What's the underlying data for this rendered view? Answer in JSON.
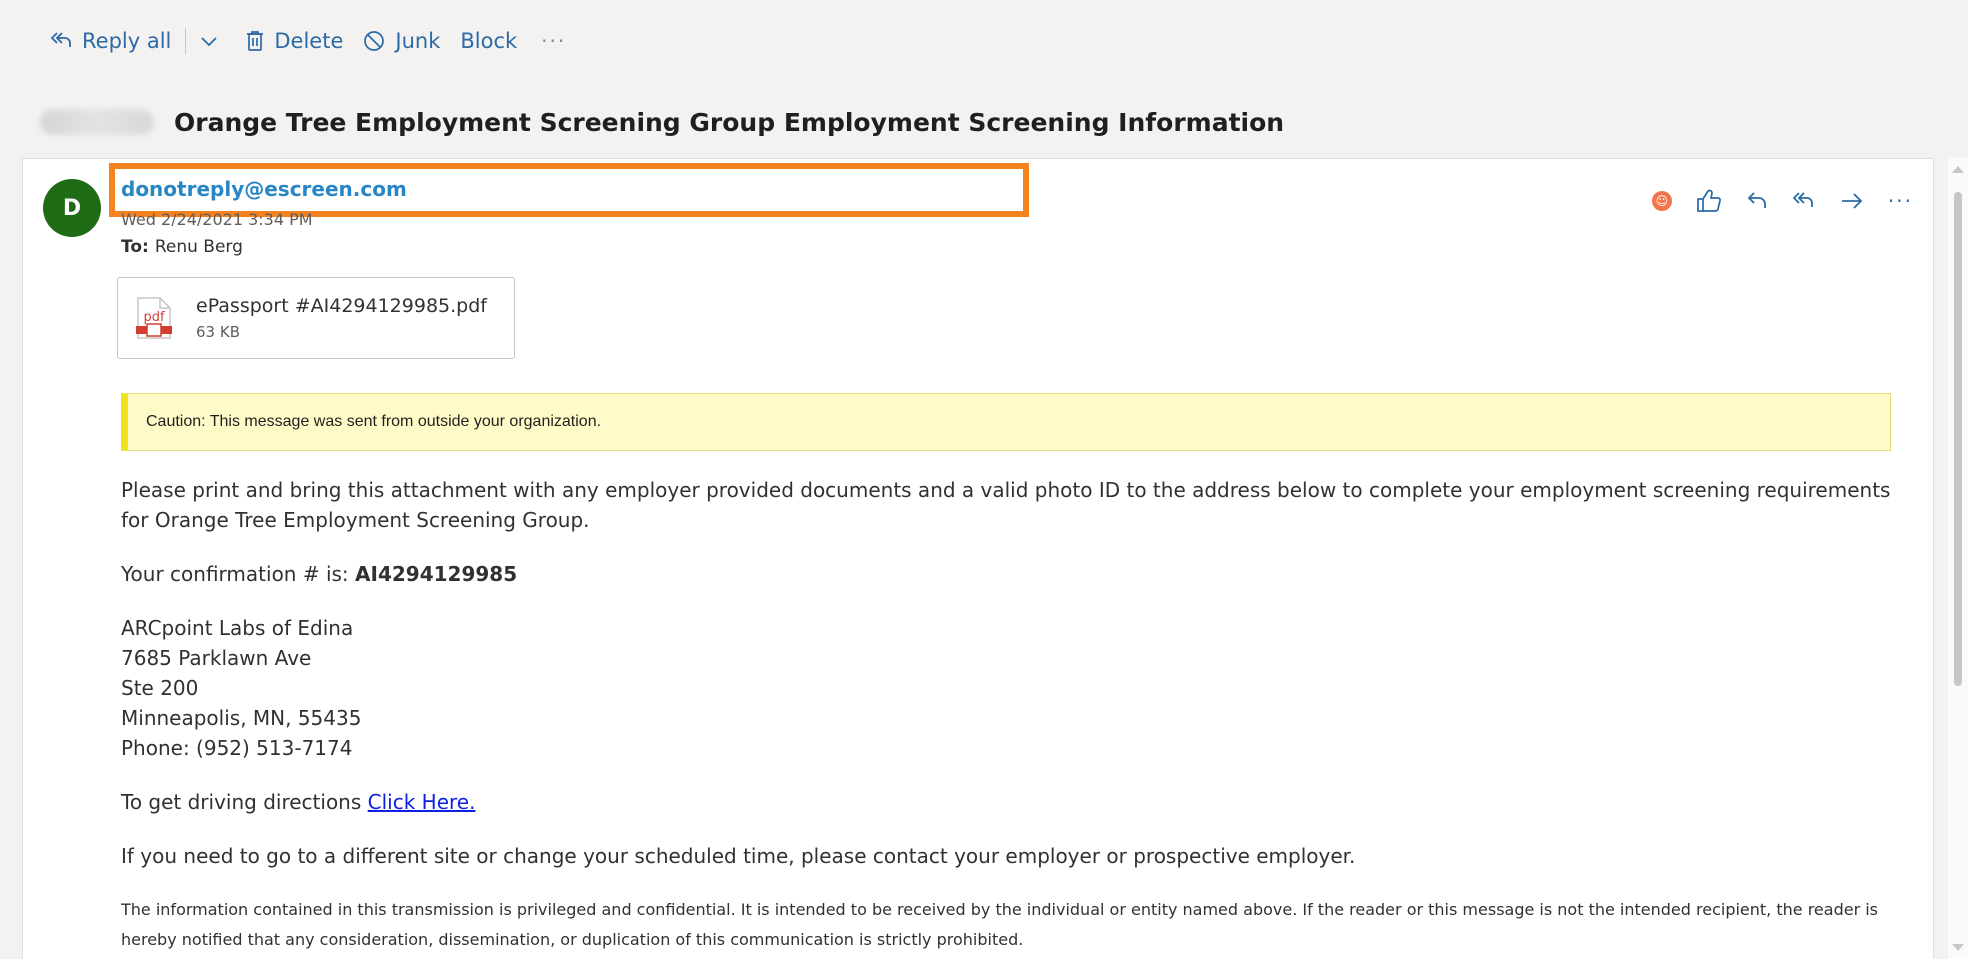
{
  "toolbar": {
    "reply_all": "Reply all",
    "delete": "Delete",
    "junk": "Junk",
    "block": "Block",
    "more": "···"
  },
  "subject": "Orange Tree Employment Screening Group Employment Screening Information",
  "message": {
    "avatar_initial": "D",
    "sender": "donotreply@escreen.com",
    "date": "Wed 2/24/2021 3:34 PM",
    "to_label": "To:",
    "to_name": "Renu Berg",
    "attachment": {
      "name": "ePassport #AI4294129985.pdf",
      "size": "63 KB",
      "icon_label": "pdf"
    },
    "caution": "Caution: This message was sent from outside your organization.",
    "body": {
      "para1": "Please print and bring this attachment with any employer provided documents and a valid photo ID to the address below to complete your employment screening requirements for Orange Tree Employment Screening Group.",
      "confirmation_label": "Your confirmation # is: ",
      "confirmation_number": "AI4294129985",
      "address": [
        "ARCpoint Labs of Edina",
        "7685 Parklawn Ave",
        "Ste 200",
        "Minneapolis, MN, 55435",
        "Phone: (952) 513-7174"
      ],
      "directions_text": "To get driving directions ",
      "directions_link": "Click Here.",
      "para_change": "If you need to go to a different site or change your scheduled time, please contact your employer or prospective employer.",
      "disclaimer": "The information contained in this transmission is privileged and confidential. It is intended to be received by the individual or entity named above. If the reader or this message is not the intended recipient, the reader is hereby notified that any consideration, dissemination, or duplication of this communication is strictly prohibited."
    }
  },
  "colors": {
    "accent": "#2b6aa6",
    "sender": "#2986c5",
    "avatar": "#1f6b16",
    "highlight": "#f5821f",
    "caution_bg": "#fffbc8",
    "link": "#0d21e3"
  },
  "icons": {
    "reply_all": "reply-all-icon",
    "delete": "trash-icon",
    "junk": "junk-icon",
    "more": "more-icon",
    "reaction": "reaction-icon",
    "like": "thumbs-up-icon",
    "reply": "reply-icon",
    "forward": "forward-icon"
  }
}
